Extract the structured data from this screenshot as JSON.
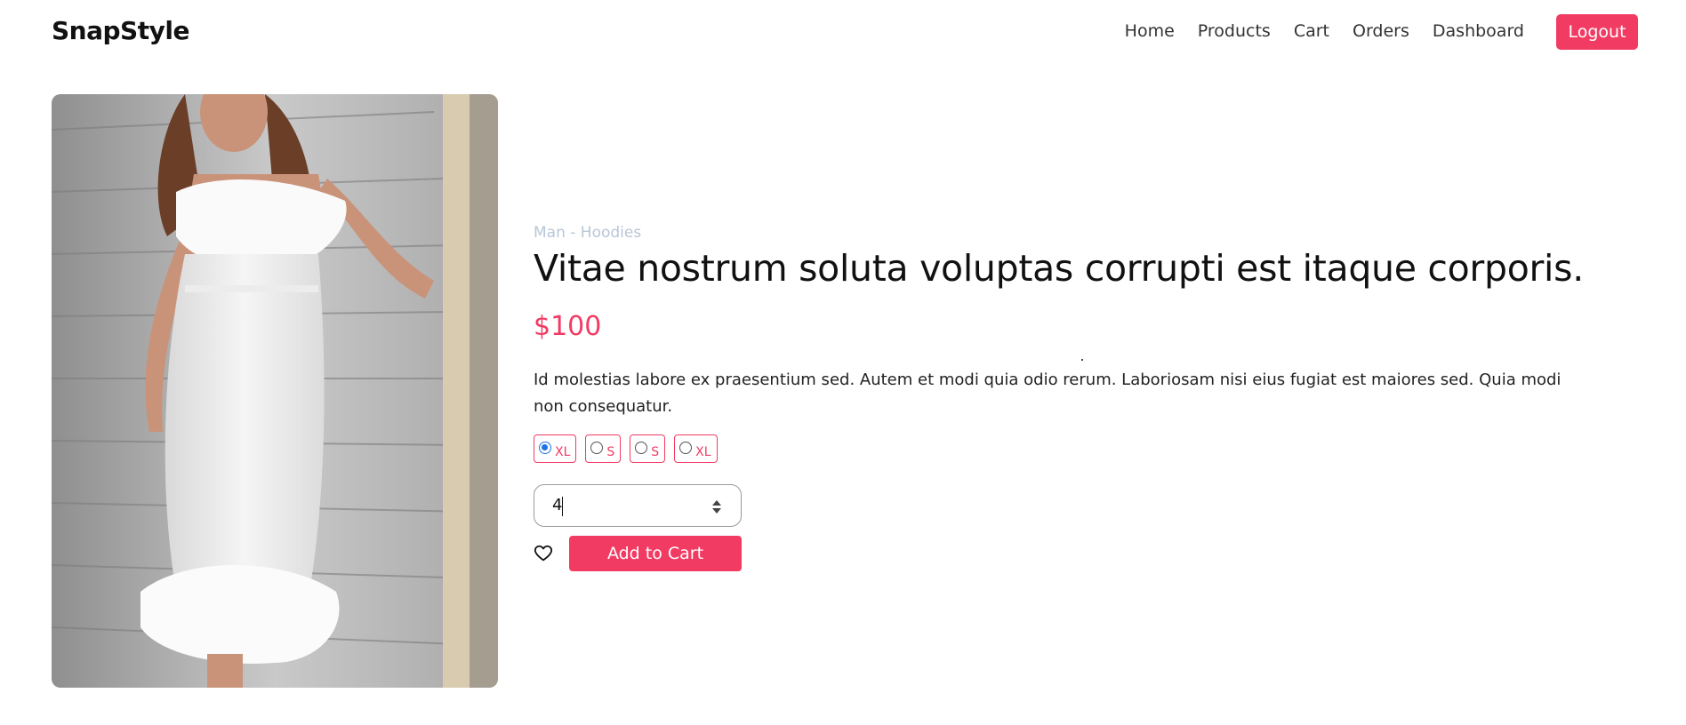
{
  "navbar": {
    "brand": "SnapStyle",
    "links": [
      "Home",
      "Products",
      "Cart",
      "Orders",
      "Dashboard"
    ],
    "logout_label": "Logout"
  },
  "product": {
    "image_icon": "product-photo-white-feather-dress",
    "category": "Man - Hoodies",
    "title": "Vitae nostrum soluta voluptas corrupti est itaque corporis.",
    "price": "$100",
    "description": "Id molestias labore ex praesentium sed. Autem et modi quia odio rerum. Laboriosam nisi eius fugiat est maiores sed. Quia modi non consequatur.",
    "sizes": [
      {
        "label": "XL",
        "checked": true
      },
      {
        "label": "S",
        "checked": false
      },
      {
        "label": "S",
        "checked": false
      },
      {
        "label": "XL",
        "checked": false
      }
    ],
    "quantity": "4",
    "wishlist_icon": "heart-icon",
    "add_to_cart_label": "Add to Cart"
  },
  "colors": {
    "accent": "#f23b63",
    "category_text": "#b8c6d6",
    "radio_checked": "#1a73e8"
  }
}
